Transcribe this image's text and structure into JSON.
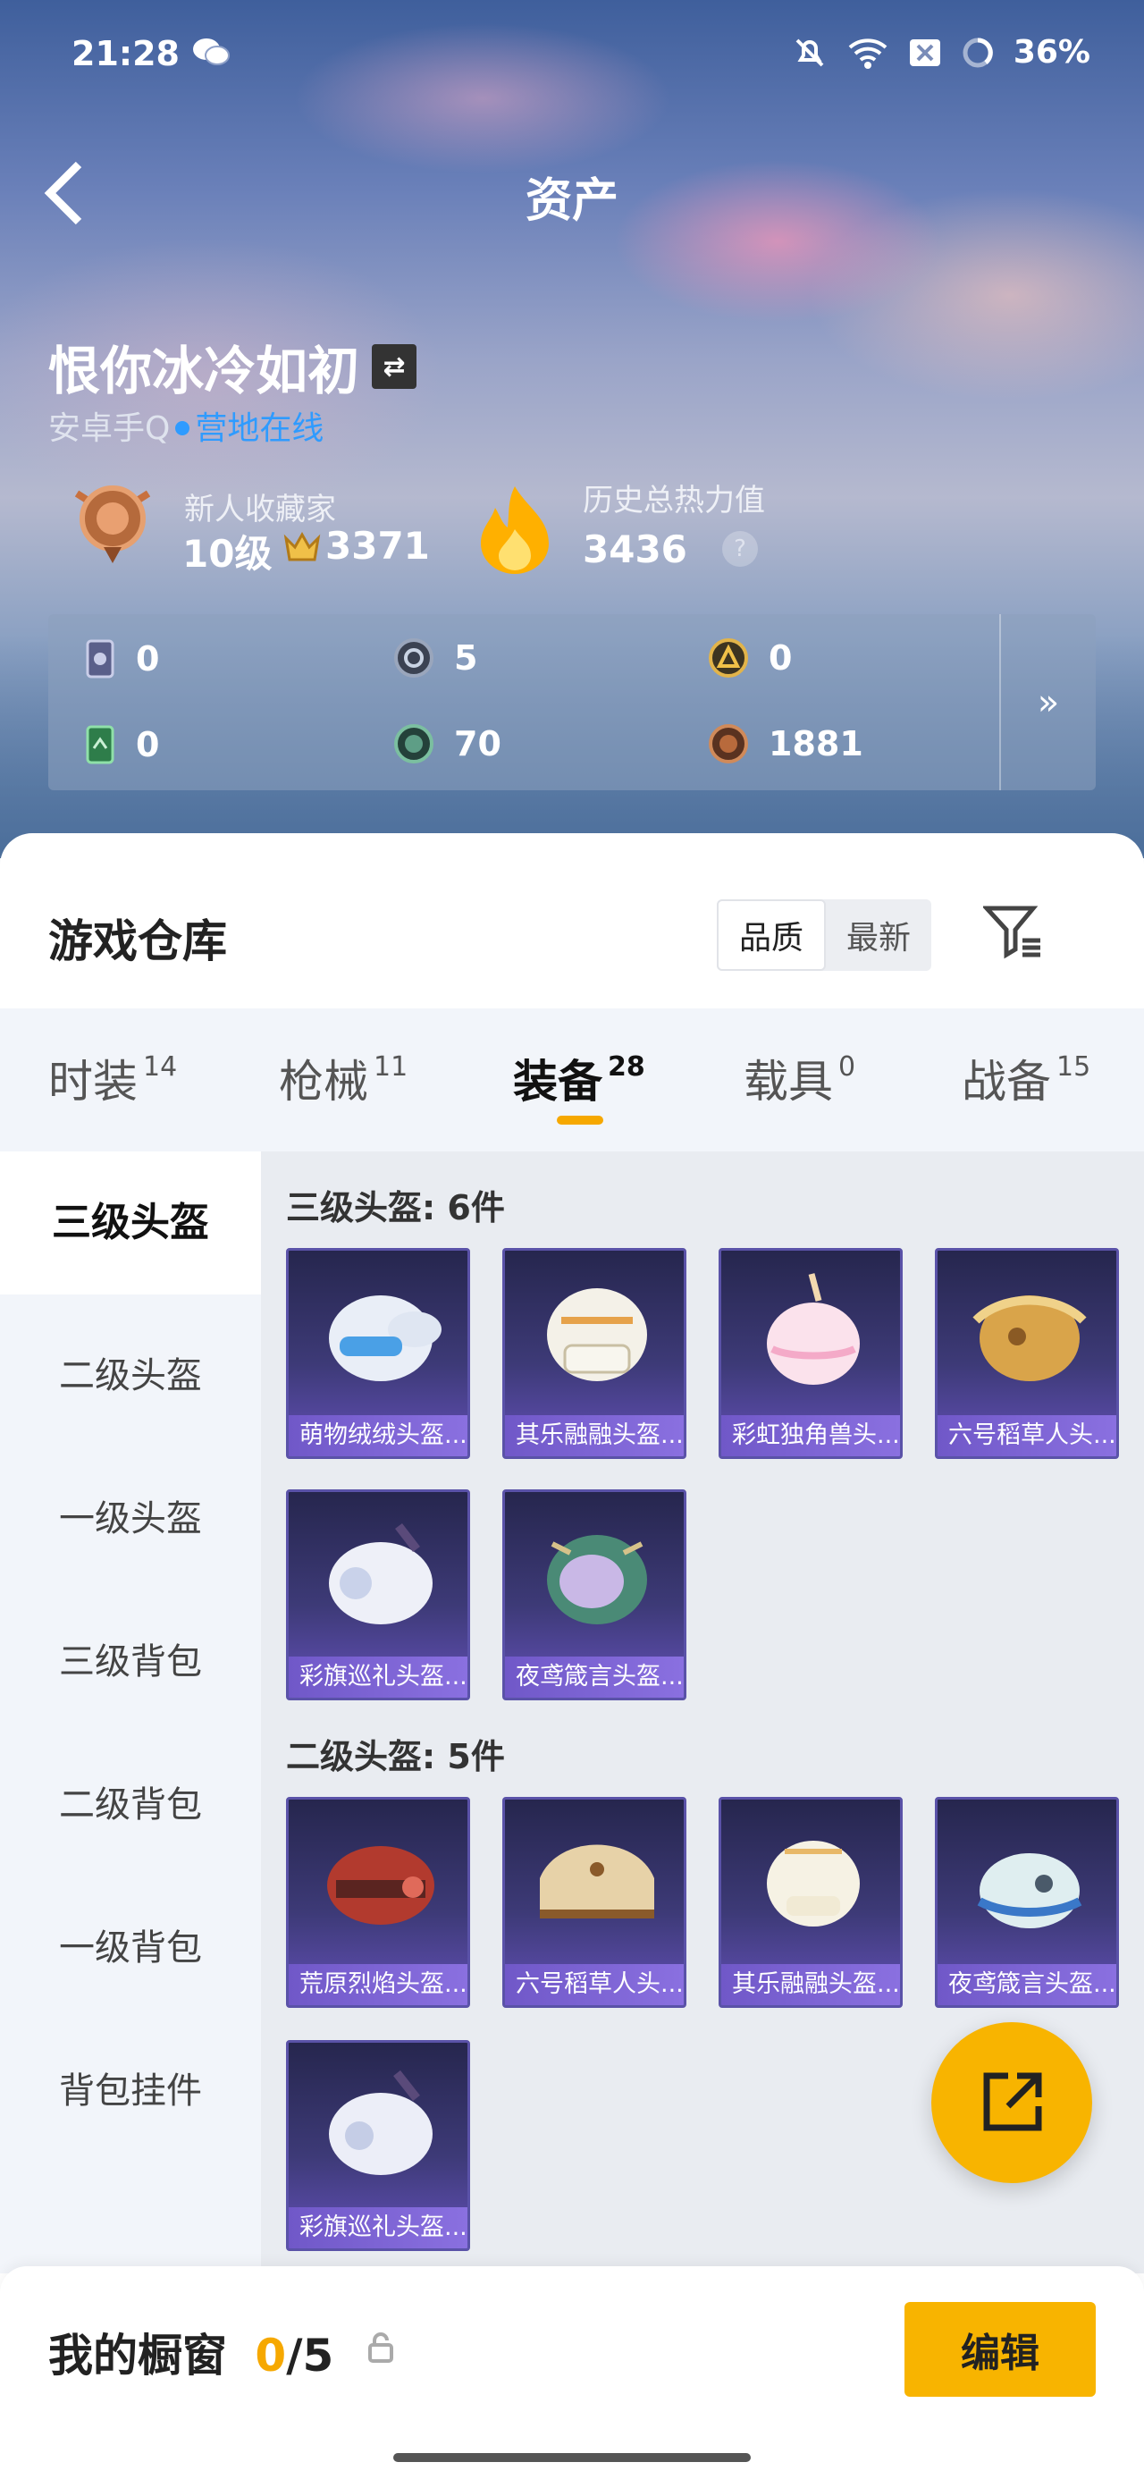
{
  "status_bar": {
    "time": "21:28",
    "battery": "36%"
  },
  "header": {
    "title": "资产"
  },
  "profile": {
    "name": "恨你冰冷如初",
    "platform": "安卓手Q",
    "online_status": "营地在线",
    "collector_title": "新人收藏家",
    "level": "10级",
    "collector_points": "3371",
    "heat_label": "历史总热力值",
    "heat_value": "3436",
    "help": "?"
  },
  "resources": [
    {
      "icon": "card-icon",
      "value": "0"
    },
    {
      "icon": "silver-coin-icon",
      "value": "5"
    },
    {
      "icon": "gold-coin-icon",
      "value": "0"
    },
    {
      "icon": "ticket-icon",
      "value": "0"
    },
    {
      "icon": "green-coin-icon",
      "value": "70"
    },
    {
      "icon": "bronze-coin-icon",
      "value": "1881"
    }
  ],
  "resources_more": "»",
  "warehouse": {
    "title": "游戏仓库",
    "sort_quality": "品质",
    "sort_newest": "最新"
  },
  "tabs": [
    {
      "label": "时装",
      "count": "14"
    },
    {
      "label": "枪械",
      "count": "11"
    },
    {
      "label": "装备",
      "count": "28"
    },
    {
      "label": "载具",
      "count": "0"
    },
    {
      "label": "战备",
      "count": "15"
    }
  ],
  "sidebar": [
    "三级头盔",
    "二级头盔",
    "一级头盔",
    "三级背包",
    "二级背包",
    "一级背包",
    "背包挂件"
  ],
  "sections": [
    {
      "title": "三级头盔: 6件",
      "items": [
        "萌物绒绒头盔...",
        "其乐融融头盔...",
        "彩虹独角兽头...",
        "六号稻草人头...",
        "彩旗巡礼头盔...",
        "夜鸢箴言头盔..."
      ]
    },
    {
      "title": "二级头盔: 5件",
      "items": [
        "荒原烈焰头盔...",
        "六号稻草人头...",
        "其乐融融头盔...",
        "夜鸢箴言头盔...",
        "彩旗巡礼头盔..."
      ]
    }
  ],
  "showcase": {
    "label": "我的橱窗",
    "used": "0",
    "total": "/5",
    "edit": "编辑"
  }
}
